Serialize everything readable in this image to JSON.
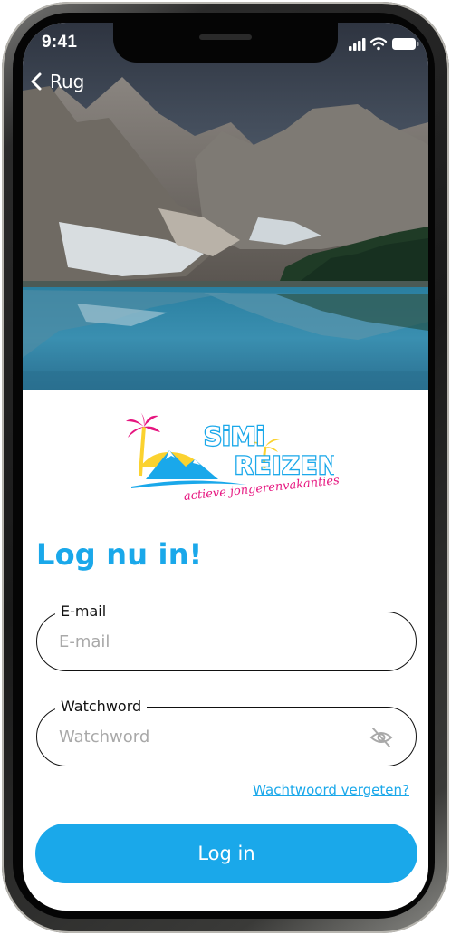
{
  "status_bar": {
    "time": "9:41"
  },
  "nav": {
    "back_label": "Rug",
    "back_icon": "chevron-left-icon"
  },
  "logo": {
    "line1": "SiMi",
    "line2": "REIZEN",
    "tagline": "actieve jongerenvakanties"
  },
  "title": "Log nu in!",
  "email": {
    "label": "E-mail",
    "placeholder": "E-mail",
    "value": ""
  },
  "password": {
    "label": "Watchword",
    "placeholder": "Watchword",
    "value": "",
    "toggle_icon": "eye-off-icon"
  },
  "forgot_link": "Wachtwoord vergeten?",
  "login_button": "Log in",
  "colors": {
    "accent": "#1aa8ea",
    "pink": "#e6157f",
    "yellow": "#fbd22f",
    "text": "#111111",
    "placeholder": "#a9a9a9"
  }
}
